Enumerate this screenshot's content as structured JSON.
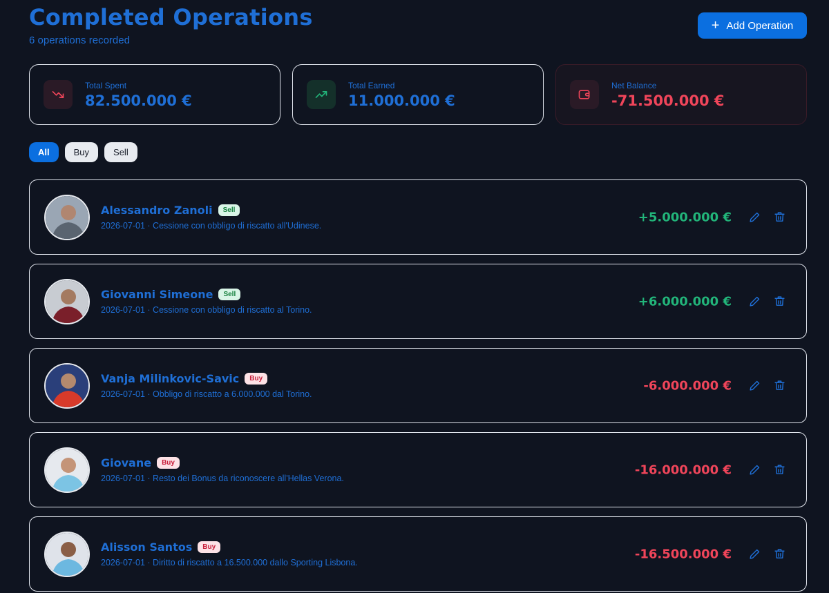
{
  "header": {
    "title": "Completed Operations",
    "subtitle": "6 operations recorded",
    "add_button": "Add Operation"
  },
  "stats": {
    "spent": {
      "label": "Total Spent",
      "value": "82.500.000 €",
      "icon": "trending-down-icon"
    },
    "earned": {
      "label": "Total Earned",
      "value": "11.000.000 €",
      "icon": "trending-up-icon"
    },
    "net": {
      "label": "Net Balance",
      "value": "-71.500.000 €",
      "icon": "wallet-icon"
    }
  },
  "filters": [
    "All",
    "Buy",
    "Sell"
  ],
  "active_filter": "All",
  "operations": [
    {
      "name": "Alessandro Zanoli",
      "type": "Sell",
      "date_desc": "2026-07-01 · Cessione con obbligo di riscatto all'Udinese.",
      "amount": "+5.000.000 €"
    },
    {
      "name": "Giovanni Simeone",
      "type": "Sell",
      "date_desc": "2026-07-01 · Cessione con obbligo di riscatto al Torino.",
      "amount": "+6.000.000 €"
    },
    {
      "name": "Vanja Milinkovic-Savic",
      "type": "Buy",
      "date_desc": "2026-07-01 · Obbligo di riscatto a 6.000.000 dal Torino.",
      "amount": "-6.000.000 €"
    },
    {
      "name": "Giovane",
      "type": "Buy",
      "date_desc": "2026-07-01 · Resto dei Bonus da riconoscere all'Hellas Verona.",
      "amount": "-16.000.000 €"
    },
    {
      "name": "Alisson Santos",
      "type": "Buy",
      "date_desc": "2026-07-01 · Diritto di riscatto a 16.500.000 dallo Sporting Lisbona.",
      "amount": "-16.500.000 €"
    }
  ],
  "colors": {
    "accent": "#0b6fe0",
    "positive": "#22b57a",
    "negative": "#f0455a",
    "background": "#0f1420"
  }
}
